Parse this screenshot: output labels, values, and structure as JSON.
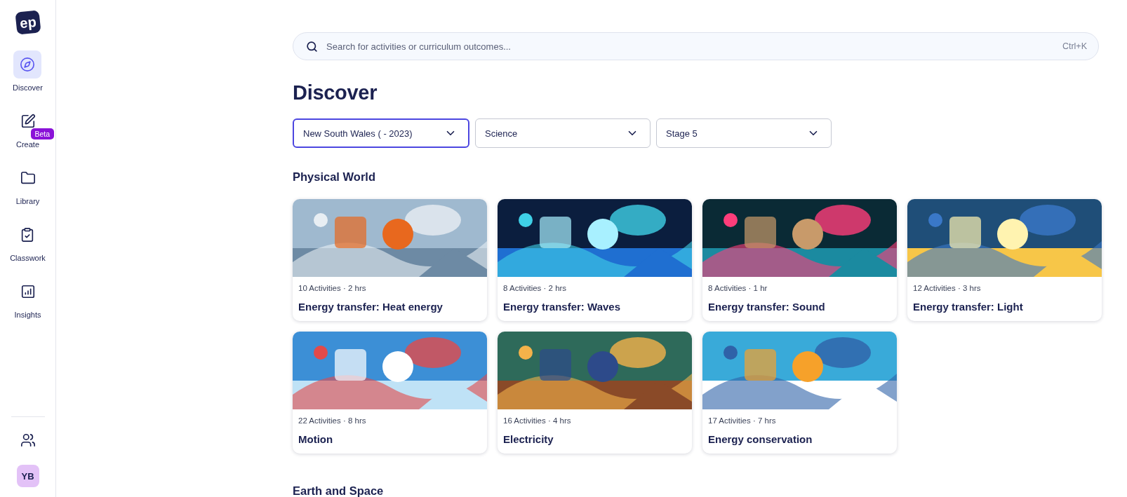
{
  "sidebar": {
    "logo": "ep",
    "items": [
      {
        "label": "Discover",
        "selected": true
      },
      {
        "label": "Create",
        "selected": false,
        "badge": "Beta"
      },
      {
        "label": "Library",
        "selected": false
      },
      {
        "label": "Classwork",
        "selected": false
      },
      {
        "label": "Insights",
        "selected": false
      }
    ],
    "avatar": "YB"
  },
  "search": {
    "placeholder": "Search for activities or curriculum outcomes...",
    "shortcut": "Ctrl+K"
  },
  "title": "Discover",
  "filters": [
    {
      "value": "New South Wales ( - 2023)",
      "focused": true
    },
    {
      "value": "Science",
      "focused": false
    },
    {
      "value": "Stage 5",
      "focused": false
    }
  ],
  "sections": [
    {
      "heading": "Physical World",
      "cards": [
        {
          "meta": "10 Activities · 2 hrs",
          "title": "Energy transfer: Heat energy"
        },
        {
          "meta": "8 Activities · 2 hrs",
          "title": "Energy transfer: Waves"
        },
        {
          "meta": "8 Activities · 1 hr",
          "title": "Energy transfer: Sound"
        },
        {
          "meta": "12 Activities · 3 hrs",
          "title": "Energy transfer: Light"
        },
        {
          "meta": "22 Activities · 8 hrs",
          "title": "Motion"
        },
        {
          "meta": "16 Activities · 4 hrs",
          "title": "Electricity"
        },
        {
          "meta": "17 Activities · 7 hrs",
          "title": "Energy conservation"
        }
      ]
    },
    {
      "heading": "Earth and Space"
    }
  ]
}
